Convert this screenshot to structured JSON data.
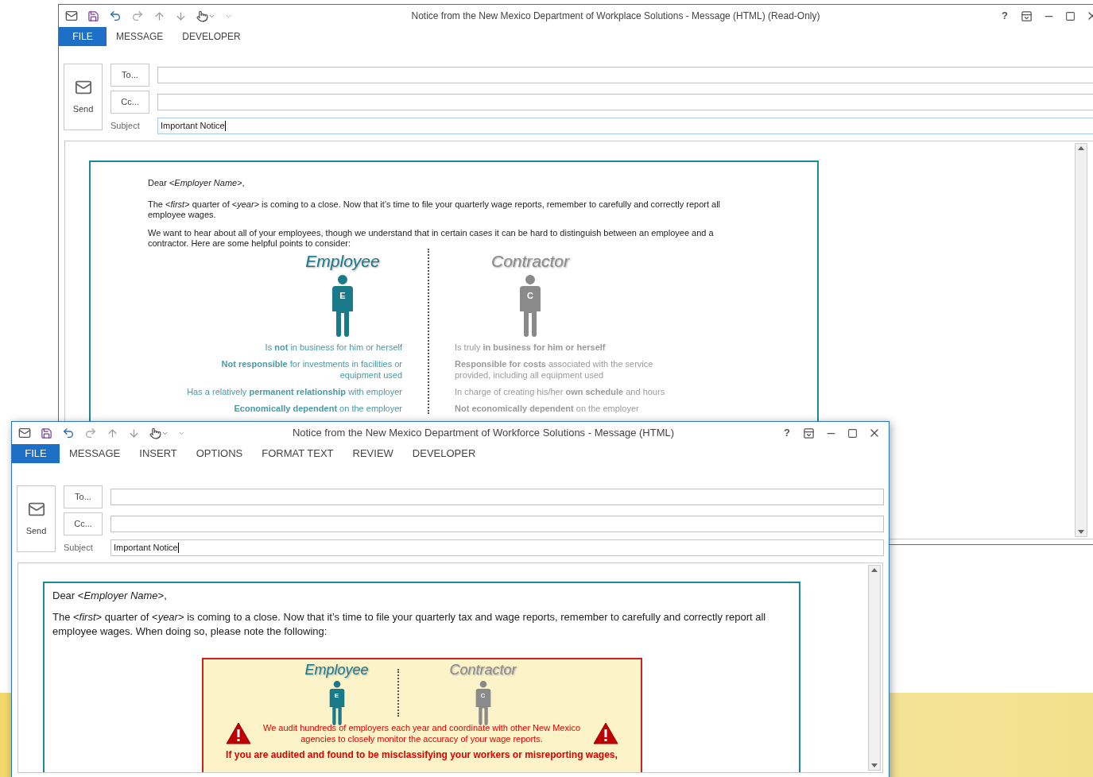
{
  "windows": [
    {
      "title": "Notice from the New Mexico Department of Workplace Solutions - Message (HTML) (Read-Only)",
      "help": "?",
      "tabs": [
        {
          "label": "FILE",
          "kind": "backstage"
        },
        {
          "label": "MESSAGE",
          "kind": "tab"
        },
        {
          "label": "DEVELOPER",
          "kind": "tab"
        }
      ],
      "send": "Send",
      "to": "To...",
      "cc": "Cc...",
      "subject_label": "Subject",
      "subject_value": "Important Notice",
      "letter": {
        "kind": "plain",
        "greeting": "Dear <*Employer Name*>,",
        "paragraphs": [
          "The <*first*> quarter of <*year*> is coming to a close. Now that it’s time to file your quarterly wage reports, remember to carefully and correctly report all employee wages.",
          "We want to hear about all of your employees, though we understand that in certain cases it can be hard to distinguish between an employee and a contractor. Here are some helpful points to consider:"
        ],
        "columns": [
          {
            "kind": "employee",
            "heading": "Employee",
            "badge": "E",
            "points": [
              "Is **not** in business for him or herself",
              "**Not responsible** for investments in facilities or equipment used",
              "Has a relatively **permanent relationship** with employer",
              "**Economically dependent** on the employer"
            ]
          },
          {
            "kind": "contractor",
            "heading": "Contractor",
            "badge": "C",
            "points": [
              "Is truly **in business for him or herself**",
              "**Responsible for costs** associated with the service provided, including all equipment used",
              "In charge of creating his/her **own schedule** and hours",
              "**Not economically dependent** on the employer"
            ]
          }
        ]
      }
    },
    {
      "title": "Notice from the New Mexico Department of Workforce Solutions - Message (HTML)",
      "help": "?",
      "tabs": [
        {
          "label": "FILE",
          "kind": "backstage"
        },
        {
          "label": "MESSAGE",
          "kind": "tab"
        },
        {
          "label": "INSERT",
          "kind": "tab"
        },
        {
          "label": "OPTIONS",
          "kind": "tab"
        },
        {
          "label": "FORMAT TEXT",
          "kind": "tab"
        },
        {
          "label": "REVIEW",
          "kind": "tab"
        },
        {
          "label": "DEVELOPER",
          "kind": "tab"
        }
      ],
      "send": "Send",
      "to": "To...",
      "cc": "Cc...",
      "subject_label": "Subject",
      "subject_value": "Important Notice",
      "letter": {
        "kind": "notice",
        "greeting": "Dear <*Employer Name*>,",
        "paragraphs": [
          "The <*first*> quarter of <*year*> is coming to a close. Now that it’s time to file your quarterly tax and wage reports, remember to carefully and correctly report all employee wages. When doing so, please note the following:"
        ],
        "columns": [
          {
            "kind": "employee",
            "heading": "Employee",
            "badge": "E"
          },
          {
            "kind": "contractor",
            "heading": "Contractor",
            "badge": "C"
          }
        ],
        "warning": "We audit hundreds of employers each year and coordinate with other New Mexico agencies to closely monitor the accuracy of your wage reports.",
        "alert": "If you are audited and found to be misclassifying your workers or misreporting wages,"
      }
    }
  ]
}
